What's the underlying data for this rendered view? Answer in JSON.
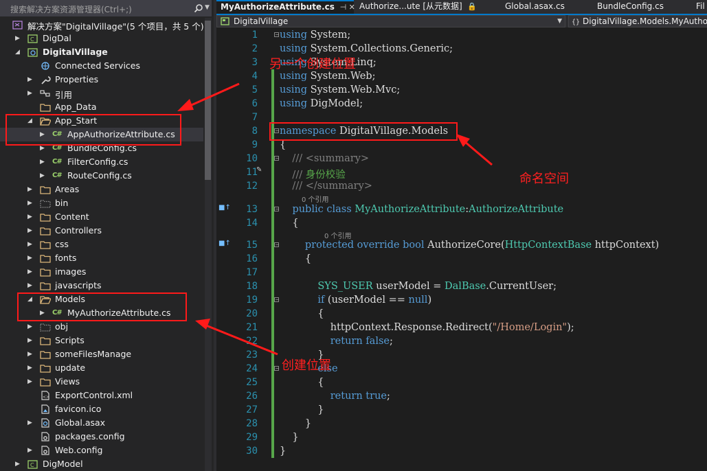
{
  "solution_explorer": {
    "search_placeholder": "搜索解决方案资源管理器(Ctrl+;)",
    "items": [
      {
        "label": "解决方案\"DigitalVillage\"(5 个项目，共 5 个)",
        "icon": "solution-icon",
        "bold": false
      },
      {
        "label": "DigDal",
        "icon": "project-icon",
        "bold": false
      },
      {
        "label": "DigitalVillage",
        "icon": "web-project-icon",
        "bold": true
      },
      {
        "label": "Connected Services",
        "icon": "connected-services-icon",
        "bold": false
      },
      {
        "label": "Properties",
        "icon": "wrench-icon",
        "bold": false
      },
      {
        "label": "引用",
        "icon": "references-icon",
        "bold": false
      },
      {
        "label": "App_Data",
        "icon": "folder-icon",
        "bold": false
      },
      {
        "label": "App_Start",
        "icon": "folder-open-icon",
        "bold": false
      },
      {
        "label": "AppAuthorizeAttribute.cs",
        "icon": "csharp-file-icon",
        "bold": false
      },
      {
        "label": "BundleConfig.cs",
        "icon": "csharp-file-icon",
        "bold": false
      },
      {
        "label": "FilterConfig.cs",
        "icon": "csharp-file-icon",
        "bold": false
      },
      {
        "label": "RouteConfig.cs",
        "icon": "csharp-file-icon",
        "bold": false
      },
      {
        "label": "Areas",
        "icon": "folder-icon",
        "bold": false
      },
      {
        "label": "bin",
        "icon": "folder-dotted-icon",
        "bold": false
      },
      {
        "label": "Content",
        "icon": "folder-icon",
        "bold": false
      },
      {
        "label": "Controllers",
        "icon": "folder-icon",
        "bold": false
      },
      {
        "label": "css",
        "icon": "folder-icon",
        "bold": false
      },
      {
        "label": "fonts",
        "icon": "folder-icon",
        "bold": false
      },
      {
        "label": "images",
        "icon": "folder-icon",
        "bold": false
      },
      {
        "label": "javascripts",
        "icon": "folder-icon",
        "bold": false
      },
      {
        "label": "Models",
        "icon": "folder-open-icon",
        "bold": false
      },
      {
        "label": "MyAuthorizeAttribute.cs",
        "icon": "csharp-file-icon",
        "bold": false
      },
      {
        "label": "obj",
        "icon": "folder-dotted-icon",
        "bold": false
      },
      {
        "label": "Scripts",
        "icon": "folder-icon",
        "bold": false
      },
      {
        "label": "someFilesManage",
        "icon": "folder-icon",
        "bold": false
      },
      {
        "label": "update",
        "icon": "folder-icon",
        "bold": false
      },
      {
        "label": "Views",
        "icon": "folder-icon",
        "bold": false
      },
      {
        "label": "ExportControl.xml",
        "icon": "xml-file-icon",
        "bold": false
      },
      {
        "label": "favicon.ico",
        "icon": "image-file-icon",
        "bold": false
      },
      {
        "label": "Global.asax",
        "icon": "asax-file-icon",
        "bold": false
      },
      {
        "label": "packages.config",
        "icon": "config-file-icon",
        "bold": false
      },
      {
        "label": "Web.config",
        "icon": "config-file-icon",
        "bold": false
      },
      {
        "label": "DigModel",
        "icon": "project-icon",
        "bold": false
      }
    ]
  },
  "tabs": [
    {
      "label": "MyAuthorizeAttribute.cs",
      "active": true
    },
    {
      "label": "Authorize...ute [从元数据]",
      "active": false
    },
    {
      "label": "Global.asax.cs",
      "active": false
    },
    {
      "label": "BundleConfig.cs",
      "active": false
    },
    {
      "label": "Fil",
      "active": false
    }
  ],
  "navbar": {
    "project": "DigitalVillage",
    "scope": "DigitalVillage.Models.MyAuthor"
  },
  "codelens": {
    "class_refs": "0 个引用",
    "method_refs": "0 个引用"
  },
  "code_lines": [
    [
      [
        "kw",
        "using"
      ],
      [
        "tx",
        " System;"
      ]
    ],
    [
      [
        "kw",
        "using"
      ],
      [
        "tx",
        " System.Collections.Generic;"
      ]
    ],
    [
      [
        "kw",
        "using"
      ],
      [
        "tx",
        " System.Linq;"
      ]
    ],
    [
      [
        "kw",
        "using"
      ],
      [
        "tx",
        " System.Web;"
      ]
    ],
    [
      [
        "kw",
        "using"
      ],
      [
        "tx",
        " System.Web.Mvc;"
      ]
    ],
    [
      [
        "kw",
        "using"
      ],
      [
        "tx",
        " DigModel;"
      ]
    ],
    [],
    [
      [
        "kw",
        "namespace"
      ],
      [
        "tx",
        " DigitalVillage.Models"
      ]
    ],
    [
      [
        "tx",
        "{"
      ]
    ],
    [
      [
        "xm",
        "    ///"
      ],
      [
        "cm",
        " "
      ],
      [
        "xm",
        "<summary>"
      ]
    ],
    [
      [
        "xm",
        "    ///"
      ],
      [
        "cm",
        " 身份校验"
      ]
    ],
    [
      [
        "xm",
        "    ///"
      ],
      [
        "cm",
        " "
      ],
      [
        "xm",
        "</summary>"
      ]
    ],
    [
      [
        "tx",
        "    "
      ],
      [
        "kw",
        "public class"
      ],
      [
        "tx",
        " "
      ],
      [
        "ty",
        "MyAuthorizeAttribute"
      ],
      [
        "tx",
        ":"
      ],
      [
        "ty",
        "AuthorizeAttribute"
      ]
    ],
    [
      [
        "tx",
        "    {"
      ]
    ],
    [
      [
        "tx",
        "        "
      ],
      [
        "kw",
        "protected override bool"
      ],
      [
        "tx",
        " AuthorizeCore("
      ],
      [
        "ty",
        "HttpContextBase"
      ],
      [
        "tx",
        " httpContext)"
      ]
    ],
    [
      [
        "tx",
        "        {"
      ]
    ],
    [],
    [
      [
        "tx",
        "            "
      ],
      [
        "ty",
        "SYS_USER"
      ],
      [
        "tx",
        " userModel = "
      ],
      [
        "ty",
        "DalBase"
      ],
      [
        "tx",
        ".CurrentUser;"
      ]
    ],
    [
      [
        "tx",
        "            "
      ],
      [
        "kw",
        "if"
      ],
      [
        "tx",
        " (userModel == "
      ],
      [
        "kw",
        "null"
      ],
      [
        "tx",
        ")"
      ]
    ],
    [
      [
        "tx",
        "            {"
      ]
    ],
    [
      [
        "tx",
        "                httpContext.Response.Redirect("
      ],
      [
        "st",
        "\"/Home/Login\""
      ],
      [
        "tx",
        ");"
      ]
    ],
    [
      [
        "tx",
        "                "
      ],
      [
        "kw",
        "return false"
      ],
      [
        "tx",
        ";"
      ]
    ],
    [
      [
        "tx",
        "            }"
      ]
    ],
    [
      [
        "tx",
        "            "
      ],
      [
        "kw",
        "else"
      ]
    ],
    [
      [
        "tx",
        "            {"
      ]
    ],
    [
      [
        "tx",
        "                "
      ],
      [
        "kw",
        "return true"
      ],
      [
        "tx",
        ";"
      ]
    ],
    [
      [
        "tx",
        "            }"
      ]
    ],
    [
      [
        "tx",
        "        }"
      ]
    ],
    [
      [
        "tx",
        "    }"
      ]
    ],
    [
      [
        "tx",
        "}"
      ]
    ]
  ],
  "annotations": {
    "another_location": "另一个创建位置",
    "namespace": "命名空间",
    "create_location": "创建位置"
  },
  "colors": {
    "annotation": "#ff1a1a",
    "keyword": "#569cd6",
    "type": "#4ec9b0",
    "comment": "#57a64a",
    "string": "#d69d85",
    "line_number": "#2b91af"
  }
}
